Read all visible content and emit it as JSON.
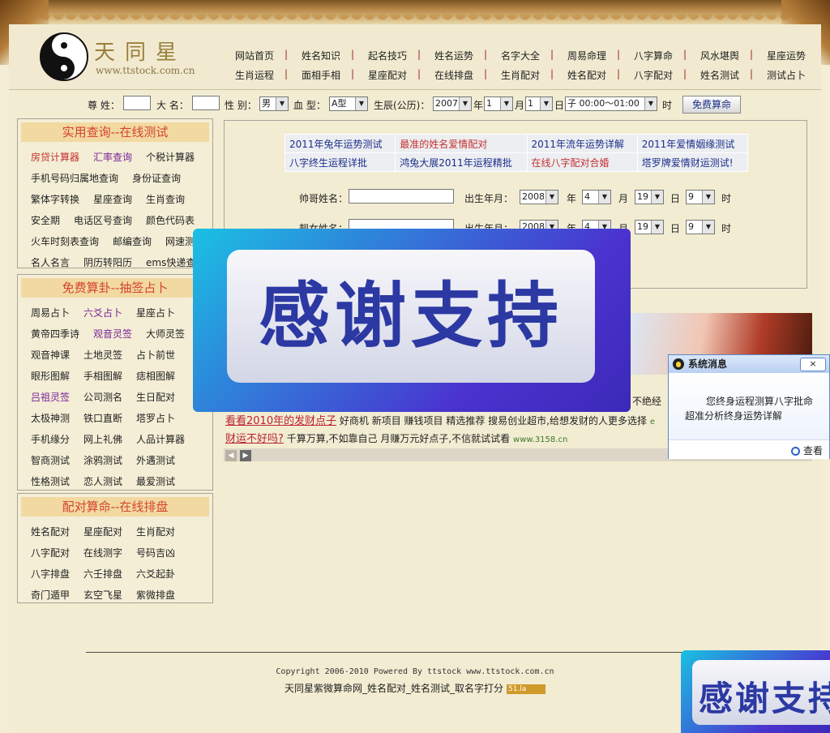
{
  "brand": {
    "name": "天同星",
    "url": "www.ttstock.com.cn"
  },
  "nav": {
    "row1": [
      "网站首页",
      "姓名知识",
      "起名技巧",
      "姓名运势",
      "名字大全",
      "周易命理",
      "八字算命",
      "风水堪舆",
      "星座运势"
    ],
    "row2": [
      "生肖运程",
      "面相手相",
      "星座配对",
      "在线排盘",
      "生肖配对",
      "姓名配对",
      "八字配对",
      "姓名测试",
      "测试占卜"
    ]
  },
  "query_form": {
    "surname_label": "尊 姓：",
    "name_label": "大 名：",
    "gender_label": "性 别：",
    "gender_value": "男",
    "blood_label": "血 型：",
    "blood_value": "A型",
    "birth_label": "生辰(公历)：",
    "year_value": "2007",
    "year_unit": "年",
    "month_value": "1",
    "month_unit": "月",
    "day_value": "1",
    "day_unit": "日",
    "hour_value": "子 00:00～01:00",
    "hour_unit": "时",
    "submit_label": "免费算命"
  },
  "sidebar": {
    "box1": {
      "title": "实用查询--在线测试",
      "rows": [
        [
          {
            "t": "房贷计算器",
            "c": "red"
          },
          {
            "t": "汇率查询",
            "c": "pur"
          },
          {
            "t": "个税计算器",
            "c": ""
          }
        ],
        [
          {
            "t": "手机号码归属地查询",
            "c": ""
          },
          {
            "t": "身份证查询",
            "c": ""
          }
        ],
        [
          {
            "t": "繁体字转换",
            "c": ""
          },
          {
            "t": "星座查询",
            "c": ""
          },
          {
            "t": "生肖查询",
            "c": ""
          }
        ],
        [
          {
            "t": "安全期",
            "c": ""
          },
          {
            "t": "电话区号查询",
            "c": ""
          },
          {
            "t": "颜色代码表",
            "c": ""
          }
        ],
        [
          {
            "t": "火车时刻表查询",
            "c": ""
          },
          {
            "t": "邮编查询",
            "c": ""
          },
          {
            "t": "网速测试",
            "c": ""
          }
        ],
        [
          {
            "t": "名人名言",
            "c": ""
          },
          {
            "t": "阴历转阳历",
            "c": ""
          },
          {
            "t": "ems快递查询",
            "c": ""
          }
        ]
      ]
    },
    "box2": {
      "title": "免费算卦--抽签占卜",
      "rows": [
        [
          {
            "t": "周易占卜",
            "c": ""
          },
          {
            "t": "六爻占卜",
            "c": "pur"
          },
          {
            "t": "星座占卜",
            "c": ""
          }
        ],
        [
          {
            "t": "黄帝四季诗",
            "c": ""
          },
          {
            "t": "观音灵签",
            "c": "pur"
          },
          {
            "t": "大师灵签",
            "c": ""
          }
        ],
        [
          {
            "t": "观音神课",
            "c": ""
          },
          {
            "t": "土地灵签",
            "c": ""
          },
          {
            "t": "占卜前世",
            "c": ""
          }
        ],
        [
          {
            "t": "眼形图解",
            "c": ""
          },
          {
            "t": "手相图解",
            "c": ""
          },
          {
            "t": "痣相图解",
            "c": ""
          }
        ],
        [
          {
            "t": "吕祖灵签",
            "c": "pur"
          },
          {
            "t": "公司测名",
            "c": ""
          },
          {
            "t": "生日配对",
            "c": ""
          }
        ],
        [
          {
            "t": "太极神测",
            "c": ""
          },
          {
            "t": "铁口直断",
            "c": ""
          },
          {
            "t": "塔罗占卜",
            "c": ""
          }
        ],
        [
          {
            "t": "手机缘分",
            "c": ""
          },
          {
            "t": "网上礼佛",
            "c": ""
          },
          {
            "t": "人品计算器",
            "c": ""
          }
        ],
        [
          {
            "t": "智商测试",
            "c": ""
          },
          {
            "t": "涂鸦测试",
            "c": ""
          },
          {
            "t": "外遇测试",
            "c": ""
          }
        ],
        [
          {
            "t": "性格测试",
            "c": ""
          },
          {
            "t": "恋人测试",
            "c": ""
          },
          {
            "t": "最爱测试",
            "c": ""
          }
        ]
      ]
    },
    "box3": {
      "title": "配对算命--在线排盘",
      "rows": [
        [
          {
            "t": "姓名配对",
            "c": ""
          },
          {
            "t": "星座配对",
            "c": ""
          },
          {
            "t": "生肖配对",
            "c": ""
          }
        ],
        [
          {
            "t": "八字配对",
            "c": ""
          },
          {
            "t": "在线测字",
            "c": ""
          },
          {
            "t": "号码吉凶",
            "c": ""
          }
        ],
        [
          {
            "t": "八字排盘",
            "c": ""
          },
          {
            "t": "六壬排盘",
            "c": ""
          },
          {
            "t": "六爻起卦",
            "c": ""
          }
        ],
        [
          {
            "t": "奇门遁甲",
            "c": ""
          },
          {
            "t": "玄空飞星",
            "c": ""
          },
          {
            "t": "紫微排盘",
            "c": ""
          }
        ]
      ]
    }
  },
  "main": {
    "links": [
      [
        {
          "t": "2011年兔年运势测试",
          "c": "blu"
        },
        {
          "t": "最准的姓名爱情配对",
          "c": "red"
        },
        {
          "t": "2011年流年运势详解",
          "c": "blu"
        },
        {
          "t": "2011年爱情姻缘测试",
          "c": "blu"
        }
      ],
      [
        {
          "t": "八字终生运程详批",
          "c": "blu"
        },
        {
          "t": "鸿兔大展2011年运程精批",
          "c": "blu"
        },
        {
          "t": "在线八字配对合婚",
          "c": "red"
        },
        {
          "t": "塔罗牌爱情财运测试!",
          "c": "blu"
        }
      ]
    ],
    "pair_form": {
      "male_label": "帅哥姓名：",
      "female_label": "靓女姓名：",
      "birth_label": "出生年月：",
      "year_value": "2008",
      "year_unit": "年",
      "month_value": "4",
      "month_unit": "月",
      "day_value": "19",
      "day_unit": "日",
      "hour_value": "9",
      "hour_unit": "时"
    },
    "ads": [
      {
        "link": "看看2010年的发财点子",
        "text": "好商机 新项目 赚钱项目 精选推荐 搜易创业超市,给想发财的人更多选择",
        "site": "e"
      },
      {
        "link": "财运不好吗?",
        "text": "千算万算,不如靠自己 月赚万元好点子,不信就试试看",
        "site": "www.3158.cn"
      }
    ],
    "ad_partial": "不绝经"
  },
  "overlay": {
    "thanks": "感谢支持",
    "thanks_small": "感谢支持"
  },
  "sysmsg": {
    "title": "系统消息",
    "close": "×",
    "line1": "您终身运程测算八字批命",
    "line2": "超准分析终身运势详解",
    "view": "查看"
  },
  "footer": {
    "copyright": "Copyright 2006-2010 Powered By ttstock www.ttstock.com.cn",
    "tagline": "天同星紫微算命网_姓名配对_姓名测试_取名字打分",
    "badge": "51.la"
  }
}
